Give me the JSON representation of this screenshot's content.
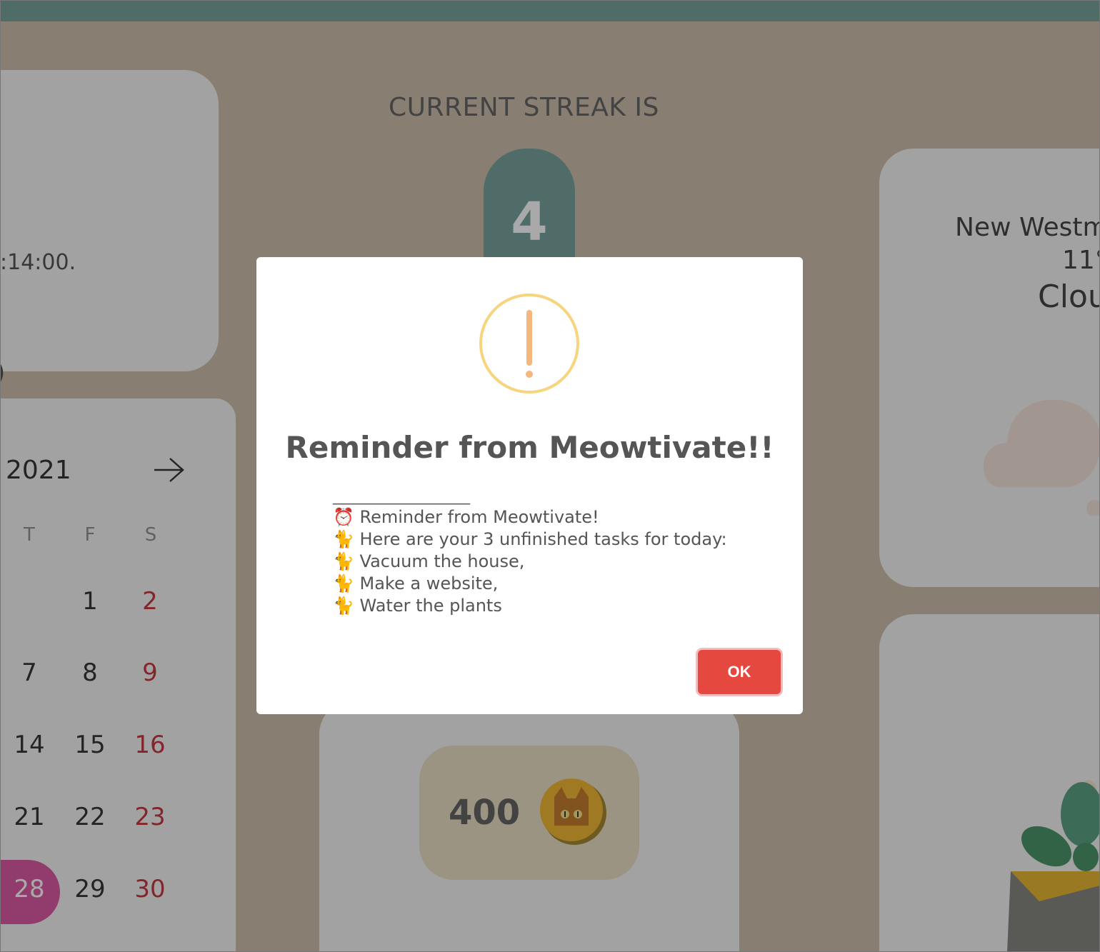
{
  "colors": {
    "accent_teal": "#6b9a94",
    "today_pink": "#d84a9a",
    "weekend_red": "#c0262d",
    "ok_button_red": "#e5483f",
    "alert_yellow": "#f7d57f",
    "alert_orange": "#f5b77e"
  },
  "reminder_card": {
    "time_fragment": ":14:00.",
    "trailing_fragment": ")"
  },
  "streak": {
    "label": "CURRENT STREAK IS",
    "value": "4"
  },
  "calendar": {
    "year": "2021",
    "next_icon": "arrow-right-icon",
    "weekday_headers": [
      "T",
      "F",
      "S"
    ],
    "weeks": [
      [
        "",
        "1",
        "2"
      ],
      [
        "7",
        "8",
        "9"
      ],
      [
        "14",
        "15",
        "16"
      ],
      [
        "21",
        "22",
        "23"
      ],
      [
        "28",
        "29",
        "30"
      ]
    ],
    "today": "28"
  },
  "coins": {
    "value": "400",
    "icon": "cat-coin-icon"
  },
  "weather": {
    "city": "New Westm",
    "temperature": "11°",
    "description": "Clou",
    "icon": "cloud-icon"
  },
  "plant": {
    "icon": "potted-plant-icon"
  },
  "dialog": {
    "icon": "exclamation-icon",
    "title": "Reminder from Meowtivate!!",
    "separator": "________________",
    "lines": [
      "⏰ Reminder from Meowtivate!",
      "🐈 Here are your 3 unfinished tasks for today:",
      "🐈 Vacuum the house,",
      "🐈 Make a website,",
      "🐈 Water the plants"
    ],
    "ok_label": "OK"
  }
}
